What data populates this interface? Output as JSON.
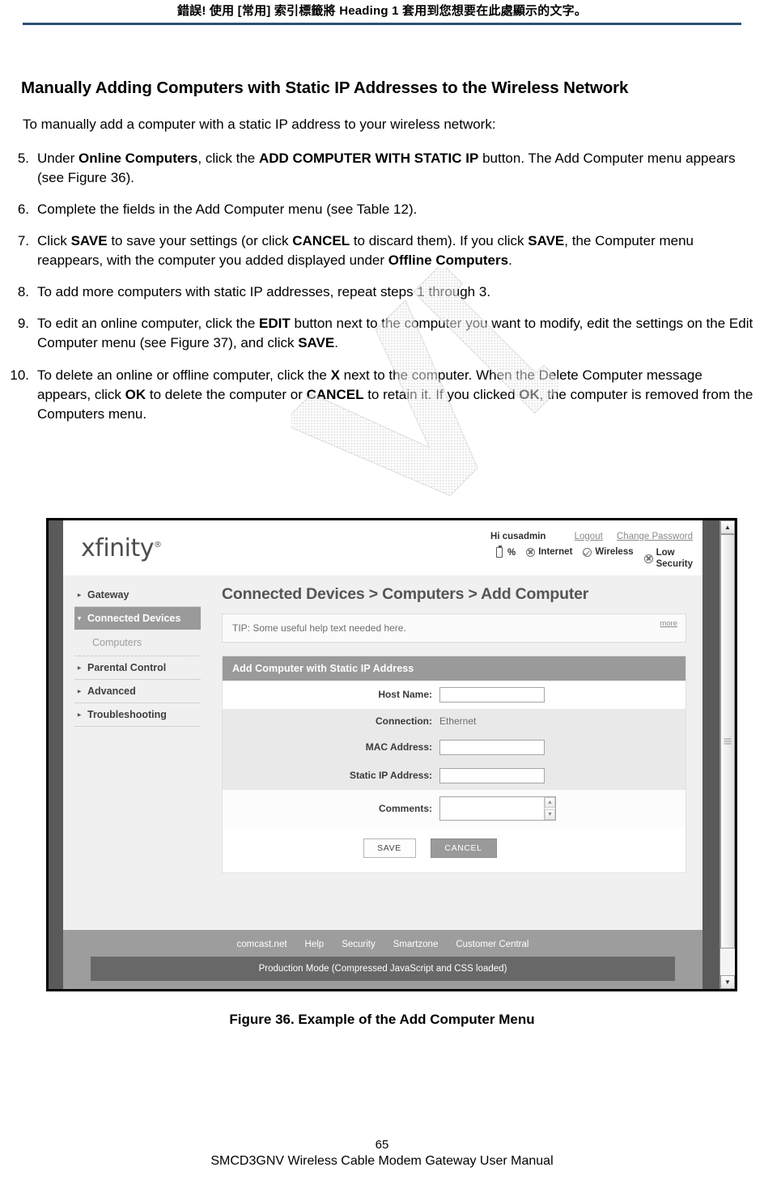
{
  "page_header": {
    "text": "錯誤! 使用 [常用] 索引標籤將 Heading 1 套用到您想要在此處顯示的文字。",
    "rule_color": "#2e5077"
  },
  "document": {
    "title": "Manually Adding Computers with Static IP Addresses to the Wireless Network",
    "intro": "To manually add a computer with a static IP address to your wireless network:",
    "steps": [
      {
        "number": "5.",
        "parts": [
          {
            "t": "Under ",
            "b": false
          },
          {
            "t": "Online Computers",
            "b": true
          },
          {
            "t": ", click the ",
            "b": false
          },
          {
            "t": "ADD COMPUTER WITH STATIC IP",
            "b": true
          },
          {
            "t": " button. The Add Computer menu appears (see Figure 36).",
            "b": false
          }
        ]
      },
      {
        "number": "6.",
        "parts": [
          {
            "t": "Complete the fields in the Add Computer menu (see Table 12).",
            "b": false
          }
        ]
      },
      {
        "number": "7.",
        "parts": [
          {
            "t": "Click ",
            "b": false
          },
          {
            "t": "SAVE",
            "b": true
          },
          {
            "t": " to save your settings (or click ",
            "b": false
          },
          {
            "t": "CANCEL",
            "b": true
          },
          {
            "t": " to discard them). If you click ",
            "b": false
          },
          {
            "t": "SAVE",
            "b": true
          },
          {
            "t": ", the Computer menu reappears, with the computer you added displayed under ",
            "b": false
          },
          {
            "t": "Offline Computers",
            "b": true
          },
          {
            "t": ".",
            "b": false
          }
        ]
      },
      {
        "number": "8.",
        "parts": [
          {
            "t": "To add more computers with static IP addresses, repeat steps 1 through 3.",
            "b": false
          }
        ]
      },
      {
        "number": "9.",
        "parts": [
          {
            "t": "To edit an online computer, click the ",
            "b": false
          },
          {
            "t": "EDIT",
            "b": true
          },
          {
            "t": " button next to the computer you want to modify, edit the settings on the Edit Computer menu (see Figure 37), and click ",
            "b": false
          },
          {
            "t": "SAVE",
            "b": true
          },
          {
            "t": ".",
            "b": false
          }
        ]
      },
      {
        "number": "10.",
        "parts": [
          {
            "t": "To delete an online or offline computer, click the ",
            "b": false
          },
          {
            "t": "X",
            "b": true
          },
          {
            "t": " next to the computer. When the Delete Computer message appears, click ",
            "b": false
          },
          {
            "t": "OK",
            "b": true
          },
          {
            "t": " to delete the computer or ",
            "b": false
          },
          {
            "t": "CANCEL",
            "b": true
          },
          {
            "t": " to retain it. If you clicked ",
            "b": false
          },
          {
            "t": "OK",
            "b": true
          },
          {
            "t": ", the computer is removed from the Computers menu.",
            "b": false
          }
        ]
      }
    ]
  },
  "figure": {
    "caption": "Figure 36. Example of the Add Computer Menu",
    "screenshot": {
      "brand": "xfinity",
      "brand_tm": "®",
      "account": {
        "greeting": "Hi cusadmin",
        "logout": "Logout",
        "change_password": "Change Password"
      },
      "status": {
        "battery_label": "%",
        "internet": "Internet",
        "wireless": "Wireless",
        "security_line1": "Low",
        "security_line2": "Security"
      },
      "sidebar": [
        {
          "label": "Gateway",
          "type": "item",
          "selected": false,
          "arrow": "▸"
        },
        {
          "label": "Connected Devices",
          "type": "item",
          "selected": true,
          "arrow": "▾"
        },
        {
          "label": "Computers",
          "type": "sub",
          "selected": false,
          "arrow": ""
        },
        {
          "label": "Parental Control",
          "type": "item",
          "selected": false,
          "arrow": "▸"
        },
        {
          "label": "Advanced",
          "type": "item",
          "selected": false,
          "arrow": "▸"
        },
        {
          "label": "Troubleshooting",
          "type": "item",
          "selected": false,
          "arrow": "▸"
        }
      ],
      "breadcrumb": "Connected Devices > Computers > Add Computer",
      "tip": {
        "text": "TIP: Some useful help text needed here.",
        "more": "more"
      },
      "panel": {
        "header": "Add Computer with Static IP Address",
        "fields": [
          {
            "label": "Host Name:",
            "control": "input",
            "value": "",
            "band": "white"
          },
          {
            "label": "Connection:",
            "control": "text",
            "value": "Ethernet",
            "band": "gray"
          },
          {
            "label": "MAC Address:",
            "control": "input",
            "value": "",
            "band": "gray"
          },
          {
            "label": "Static IP Address:",
            "control": "input",
            "value": "",
            "band": "gray"
          },
          {
            "label": "Comments:",
            "control": "textarea",
            "value": "",
            "band": "white2"
          }
        ],
        "buttons": {
          "save": "SAVE",
          "cancel": "CANCEL"
        }
      },
      "footer": {
        "links": [
          "comcast.net",
          "Help",
          "Security",
          "Smartzone",
          "Customer Central"
        ],
        "production_banner": "Production Mode (Compressed JavaScript and CSS loaded)"
      }
    }
  },
  "page_footer": {
    "page_number": "65",
    "manual": "SMCD3GNV Wireless Cable Modem Gateway User Manual"
  }
}
